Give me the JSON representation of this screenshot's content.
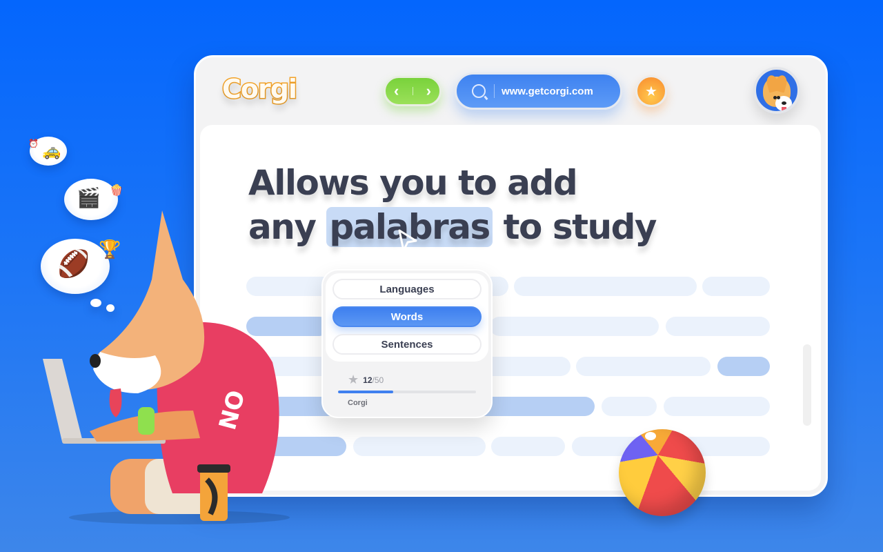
{
  "browser": {
    "logo": "Corgi",
    "nav": {
      "back_icon": "‹",
      "forward_icon": "›"
    },
    "url": "www.getcorgi.com",
    "favorite_icon": "★",
    "avatar_label": "corgi avatar"
  },
  "headline": {
    "line1": "Allows you to add",
    "line2_before": "any",
    "line2_highlight": "palabras",
    "line2_after": "to study"
  },
  "popup": {
    "options": [
      {
        "label": "Languages",
        "active": false
      },
      {
        "label": "Words",
        "active": true
      },
      {
        "label": "Sentences",
        "active": false
      }
    ],
    "progress": {
      "current": "12",
      "total": "/50",
      "fraction": 0.4
    },
    "star_icon": "★",
    "brand": "Corgi"
  },
  "thought_bubbles": [
    {
      "main": "🚕",
      "accent": "⏰"
    },
    {
      "main": "🎬",
      "accent": "🍿"
    },
    {
      "main": "🏈",
      "accent": "🏆"
    }
  ],
  "colors": {
    "background": "#0466fd",
    "accent_blue": "#3f80ef",
    "nav_green": "#79d23b",
    "star_orange": "#f98a2e",
    "logo_orange": "#f2a228",
    "text_dark": "#3a3f52",
    "highlight": "#c8dbf6"
  }
}
